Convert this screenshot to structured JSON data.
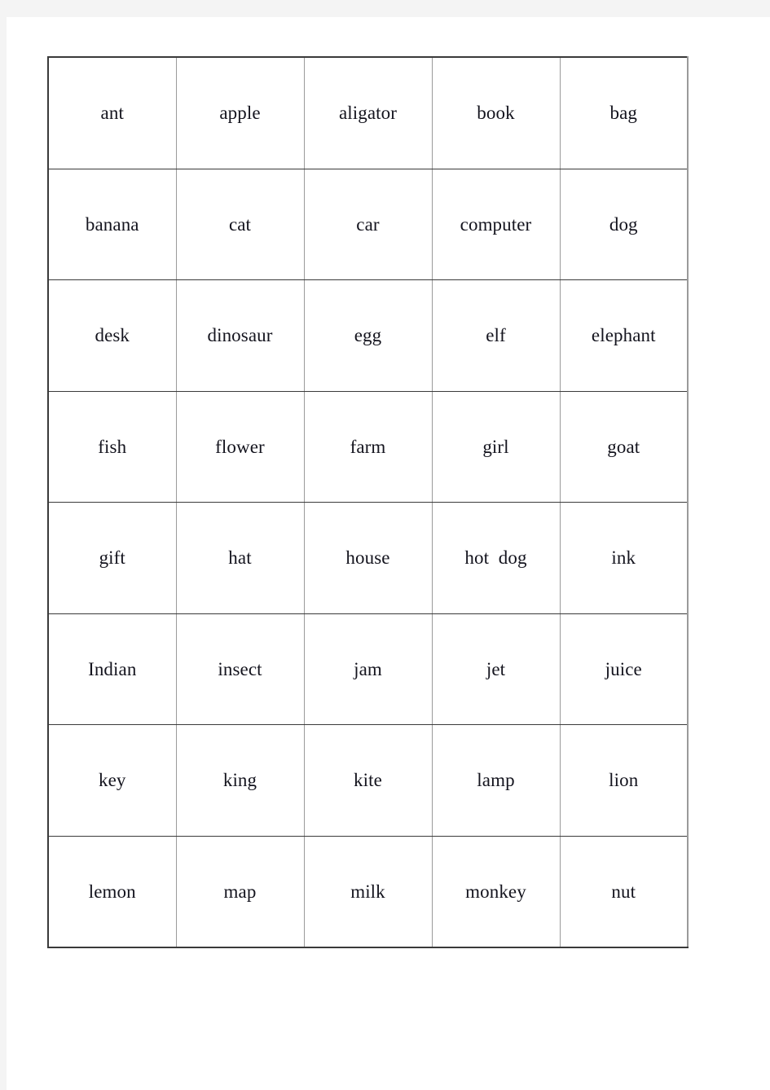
{
  "document": {
    "type": "word-grid-worksheet",
    "columns": 5,
    "rows": 8,
    "page_background": "#ffffff",
    "gutter_color": "#f4f4f4",
    "text_color": "#14141e",
    "outer_border_color": "#3a3a3a",
    "inner_vertical_border_color": "#9a9a9a",
    "inner_horizontal_border_color": "#3a3a3a"
  },
  "table": {
    "rows": [
      {
        "cells": [
          "ant",
          "apple",
          "aligator",
          "book",
          "bag"
        ]
      },
      {
        "cells": [
          "banana",
          "cat",
          "car",
          "computer",
          "dog"
        ]
      },
      {
        "cells": [
          "desk",
          "dinosaur",
          "egg",
          "elf",
          "elephant"
        ]
      },
      {
        "cells": [
          "fish",
          "flower",
          "farm",
          "girl",
          "goat"
        ]
      },
      {
        "cells": [
          "gift",
          "hat",
          "house",
          "hot  dog",
          "ink"
        ]
      },
      {
        "cells": [
          "Indian",
          "insect",
          "jam",
          "jet",
          "juice"
        ]
      },
      {
        "cells": [
          "key",
          "king",
          "kite",
          "lamp",
          "lion"
        ]
      },
      {
        "cells": [
          "lemon",
          "map",
          "milk",
          "monkey",
          "nut"
        ]
      }
    ]
  }
}
